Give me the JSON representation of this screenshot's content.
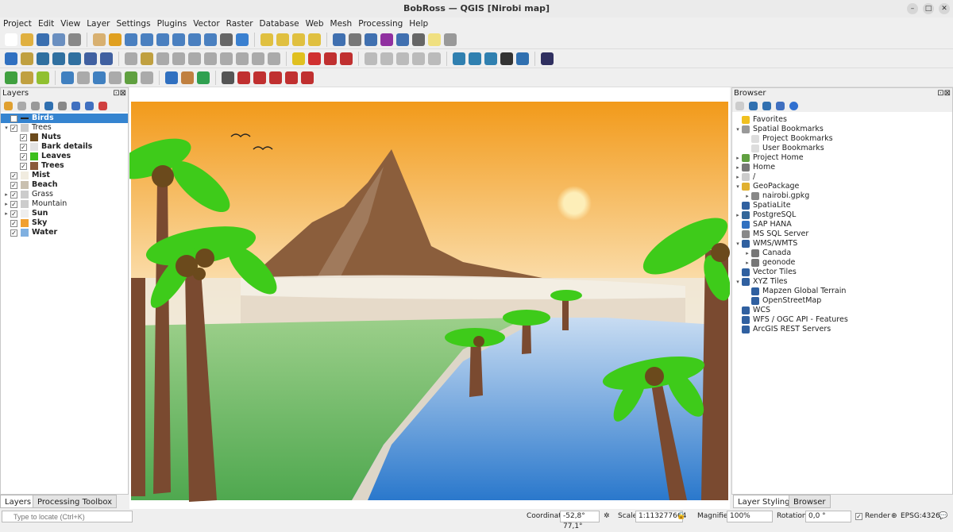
{
  "window": {
    "title": "BobRoss — QGIS [Nirobi map]"
  },
  "menu": [
    "Project",
    "Edit",
    "View",
    "Layer",
    "Settings",
    "Plugins",
    "Vector",
    "Raster",
    "Database",
    "Web",
    "Mesh",
    "Processing",
    "Help"
  ],
  "toolbars": [
    [
      "#ffffff",
      "#e0b040",
      "#3a6fb0",
      "#6a8fc0",
      "#888888",
      "sep",
      "#d8b070",
      "#e0a020",
      "#4a80c0",
      "#4a80c0",
      "#4a80c0",
      "#4a80c0",
      "#4a80c0",
      "#4a80c0",
      "#666666",
      "#3a80d0",
      "sep",
      "#e0c040",
      "#e0c040",
      "#e0c040",
      "#e0c040",
      "sep",
      "#4070b0",
      "#777777",
      "#4070b0",
      "#9030a0",
      "#4070b0",
      "#666666",
      "#f0e080",
      "#999999"
    ],
    [
      "#3070c0",
      "#c0a040",
      "#3070a0",
      "#3070a0",
      "#3070a0",
      "#4060a0",
      "#4060a0",
      "sep",
      "#aaaaaa",
      "#c0a040",
      "#aaaaaa",
      "#aaaaaa",
      "#aaaaaa",
      "#aaaaaa",
      "#aaaaaa",
      "#aaaaaa",
      "#aaaaaa",
      "#aaaaaa",
      "sep",
      "#e0c020",
      "#d03030",
      "#c03030",
      "#c03030",
      "sep",
      "#bbbbbb",
      "#bbbbbb",
      "#bbbbbb",
      "#bbbbbb",
      "#bbbbbb",
      "sep",
      "#3080b0",
      "#3080b0",
      "#3080b0",
      "#333333",
      "#3070b0",
      "sep",
      "#303060"
    ],
    [
      "#40a040",
      "#c0a040",
      "#90c030",
      "sep",
      "#4080c0",
      "#aaaaaa",
      "#4080c0",
      "#aaaaaa",
      "#60a040",
      "#aaaaaa",
      "sep",
      "#3070c0",
      "#c08040",
      "#30a050",
      "sep",
      "#555555",
      "#c03030",
      "#c03030",
      "#c03030",
      "#c03030",
      "#c03030"
    ]
  ],
  "layers_panel": {
    "title": "Layers",
    "items": [
      {
        "label": "Birds",
        "bold": true,
        "selected": true,
        "swatch": "line",
        "indent": 0,
        "arrow": ""
      },
      {
        "label": "Trees",
        "bold": false,
        "swatch": "group",
        "indent": 0,
        "arrow": "▾"
      },
      {
        "label": "Nuts",
        "bold": true,
        "swatch": "#6b4a1c",
        "indent": 1,
        "arrow": ""
      },
      {
        "label": "Bark details",
        "bold": true,
        "swatch": "#e2e2e2",
        "indent": 1,
        "arrow": ""
      },
      {
        "label": "Leaves",
        "bold": true,
        "swatch": "#3cbf1c",
        "indent": 1,
        "arrow": ""
      },
      {
        "label": "Trees",
        "bold": true,
        "swatch": "#8a5a3c",
        "indent": 1,
        "arrow": ""
      },
      {
        "label": "Mist",
        "bold": true,
        "swatch": "#f1ece0",
        "indent": 0,
        "arrow": ""
      },
      {
        "label": "Beach",
        "bold": true,
        "swatch": "#c9c0b0",
        "indent": 0,
        "arrow": ""
      },
      {
        "label": "Grass",
        "bold": false,
        "swatch": "group",
        "indent": 0,
        "arrow": "▸"
      },
      {
        "label": "Mountain",
        "bold": false,
        "swatch": "group",
        "indent": 0,
        "arrow": "▸"
      },
      {
        "label": "Sun",
        "bold": true,
        "swatch": "#eeeeee",
        "indent": 0,
        "arrow": "▸"
      },
      {
        "label": "Sky",
        "bold": true,
        "swatch": "#f0a030",
        "indent": 0,
        "arrow": ""
      },
      {
        "label": "Water",
        "bold": true,
        "swatch": "#80b0e0",
        "indent": 0,
        "arrow": ""
      }
    ]
  },
  "browser_panel": {
    "title": "Browser",
    "items": [
      {
        "label": "Favorites",
        "icon": "star-icon",
        "color": "#f0c020",
        "indent": 0,
        "arrow": ""
      },
      {
        "label": "Spatial Bookmarks",
        "icon": "bookmark-icon",
        "color": "#999999",
        "indent": 0,
        "arrow": "▾"
      },
      {
        "label": "Project Bookmarks",
        "icon": "folder-icon",
        "color": "#dddddd",
        "indent": 1,
        "arrow": ""
      },
      {
        "label": "User Bookmarks",
        "icon": "folder-icon",
        "color": "#dddddd",
        "indent": 1,
        "arrow": ""
      },
      {
        "label": "Project Home",
        "icon": "home-folder-icon",
        "color": "#60a040",
        "indent": 0,
        "arrow": "▸"
      },
      {
        "label": "Home",
        "icon": "home-icon",
        "color": "#777777",
        "indent": 0,
        "arrow": "▸"
      },
      {
        "label": "/",
        "icon": "folder-icon",
        "color": "#cccccc",
        "indent": 0,
        "arrow": "▸"
      },
      {
        "label": "GeoPackage",
        "icon": "geopackage-icon",
        "color": "#e0b030",
        "indent": 0,
        "arrow": "▾"
      },
      {
        "label": "nairobi.gpkg",
        "icon": "database-icon",
        "color": "#888888",
        "indent": 1,
        "arrow": "▸"
      },
      {
        "label": "SpatiaLite",
        "icon": "spatialite-icon",
        "color": "#3060a0",
        "indent": 0,
        "arrow": ""
      },
      {
        "label": "PostgreSQL",
        "icon": "postgres-icon",
        "color": "#336699",
        "indent": 0,
        "arrow": "▸"
      },
      {
        "label": "SAP HANA",
        "icon": "sap-icon",
        "color": "#3070c0",
        "indent": 0,
        "arrow": ""
      },
      {
        "label": "MS SQL Server",
        "icon": "mssql-icon",
        "color": "#888888",
        "indent": 0,
        "arrow": ""
      },
      {
        "label": "WMS/WMTS",
        "icon": "globe-icon",
        "color": "#3060a0",
        "indent": 0,
        "arrow": "▾"
      },
      {
        "label": "Canada",
        "icon": "connection-icon",
        "color": "#777777",
        "indent": 1,
        "arrow": "▸"
      },
      {
        "label": "geonode",
        "icon": "connection-icon",
        "color": "#777777",
        "indent": 1,
        "arrow": "▸"
      },
      {
        "label": "Vector Tiles",
        "icon": "grid-icon",
        "color": "#3060a0",
        "indent": 0,
        "arrow": ""
      },
      {
        "label": "XYZ Tiles",
        "icon": "grid-icon",
        "color": "#3060a0",
        "indent": 0,
        "arrow": "▾"
      },
      {
        "label": "Mapzen Global Terrain",
        "icon": "grid-icon",
        "color": "#3060a0",
        "indent": 1,
        "arrow": ""
      },
      {
        "label": "OpenStreetMap",
        "icon": "grid-icon",
        "color": "#3060a0",
        "indent": 1,
        "arrow": ""
      },
      {
        "label": "WCS",
        "icon": "globe-icon",
        "color": "#3060a0",
        "indent": 0,
        "arrow": ""
      },
      {
        "label": "WFS / OGC API - Features",
        "icon": "globe-icon",
        "color": "#3060a0",
        "indent": 0,
        "arrow": ""
      },
      {
        "label": "ArcGIS REST Servers",
        "icon": "globe-icon",
        "color": "#3060a0",
        "indent": 0,
        "arrow": ""
      }
    ]
  },
  "left_tabs": [
    "Layers",
    "Processing Toolbox"
  ],
  "right_tabs": [
    "Layer Styling",
    "Browser"
  ],
  "status": {
    "locator_placeholder": "Type to locate (Ctrl+K)",
    "coordinate_label": "Coordinate",
    "coordinate": "-52,8° 77,1°",
    "scale_label": "Scale",
    "scale": "1:113277664",
    "magnifier_label": "Magnifier",
    "magnifier": "100%",
    "rotation_label": "Rotation",
    "rotation": "0,0 °",
    "render_label": "Render",
    "crs": "EPSG:4326"
  }
}
